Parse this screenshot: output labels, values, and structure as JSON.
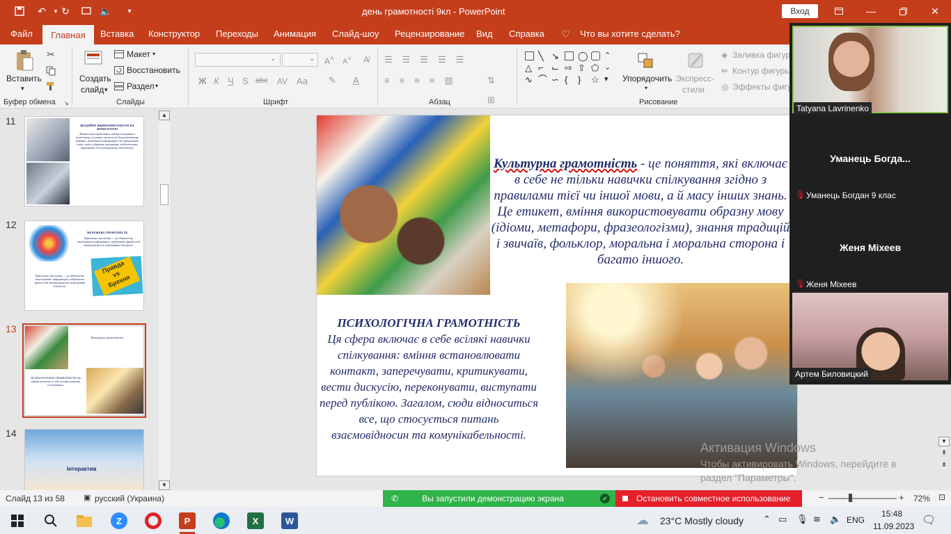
{
  "titlebar": {
    "title": "день грамотності 9кл  -  PowerPoint",
    "signin": "Вход",
    "quick_access": [
      "save-icon",
      "undo-icon",
      "redo-icon",
      "present-icon",
      "volume-icon",
      "customize-icon"
    ]
  },
  "tabs": [
    "Файл",
    "Главная",
    "Вставка",
    "Конструктор",
    "Переходы",
    "Анимация",
    "Слайд-шоу",
    "Рецензирование",
    "Вид",
    "Справка",
    "Что вы хотите сделать?"
  ],
  "ribbon": {
    "paste": "Вставить",
    "clipboard": "Буфер обмена",
    "new_slide": [
      "Создать",
      "слайд"
    ],
    "layout": "Макет",
    "reset": "Восстановить",
    "section": "Раздел",
    "slides": "Слайды",
    "font": "Шрифт",
    "font_buttons": [
      "Ж",
      "К",
      "Ч",
      "S",
      "abc",
      "Аа"
    ],
    "paragraph": "Абзац",
    "arrange": "Упорядочить",
    "express": [
      "Экспресс-",
      "стили"
    ],
    "fill": "Заливка фигуры",
    "outline": "Контур фигуры",
    "effects": "Эффекты фигуры",
    "drawing": "Рисование"
  },
  "thumbnails": [
    {
      "num": "11",
      "title": "ВОЗДІЙНЕ ВЖИВАННЯ РОБОТИ НА КОМП'ЮТЕРІ",
      "body": "Вміння цілеспрямовано використовувати комп'ютер і новітні технології для розв'язання завдань, знаходити інформацію та працювати з нею, вміло обирати програмне забезпечення, оцінювати її достовірність та безпеку."
    },
    {
      "num": "12",
      "title": "МЕРЕЖЕВА ГРАМОТНІСТЬ",
      "body": "Критичне мислення — це здатність аналізувати інформацію, відрізняти факти від маніпуляцій та перевіряти джерела.",
      "badge": [
        "Правда",
        "vs",
        "Брехня"
      ]
    },
    {
      "num": "13",
      "title": "Культурна грамотність",
      "body": "ПСИХОЛОГІЧНА ГРАМОТНІСТЬ Ця сфера включає в себе всілякі навички спілкування."
    },
    {
      "num": "14",
      "label": "Інтерактив"
    }
  ],
  "slide": {
    "p1_title": "Культурна грамотність",
    "p1_text": " - це поняття, які включає в себе не тільки навички спілкування згідно з правилами тієї чи іншої мови, а й масу інших знань. Це етикет, вміння використовувати образну мову (ідіоми, метафори, фразеологізми), знання традицій і звичаїв, фольклор, моральна і моральна сторона і багато іншого.",
    "p2_title": "ПСИХОЛОГІЧНА ГРАМОТНІСТЬ",
    "p2_text": "Ця сфера включає в себе всілякі навички спілкування: вміння встановлювати контакт, заперечувати, критикувати, вести дискусію, переконувати, виступати перед публікою. Загалом, сюди відноситься все, що стосується питань взаємовідносин та комунікабельності."
  },
  "video": {
    "tiles": [
      {
        "label": "Tatyana Lavrinenko"
      },
      {
        "name": "Уманець  Богда...",
        "label": "Уманець Богдан 9 клас"
      },
      {
        "name": "Женя Міхеев",
        "label": "Женя Міхеев"
      },
      {
        "label": "Артем Биловицкий"
      }
    ]
  },
  "status": {
    "slide_of": "Слайд 13 из 58",
    "language": "русский (Украина)",
    "zoom": "72%",
    "share_msg": "Вы запустили демонстрацию экрана",
    "stop_share": "Остановить совместное использование"
  },
  "watermark": {
    "line1": "Активация Windows",
    "line2": "Чтобы активировать Windows, перейдите в раздел \"Параметры\"."
  },
  "taskbar": {
    "weather": "23°C  Mostly cloudy",
    "lang": "ENG",
    "time": "15:48",
    "date": "11.09.2023"
  }
}
